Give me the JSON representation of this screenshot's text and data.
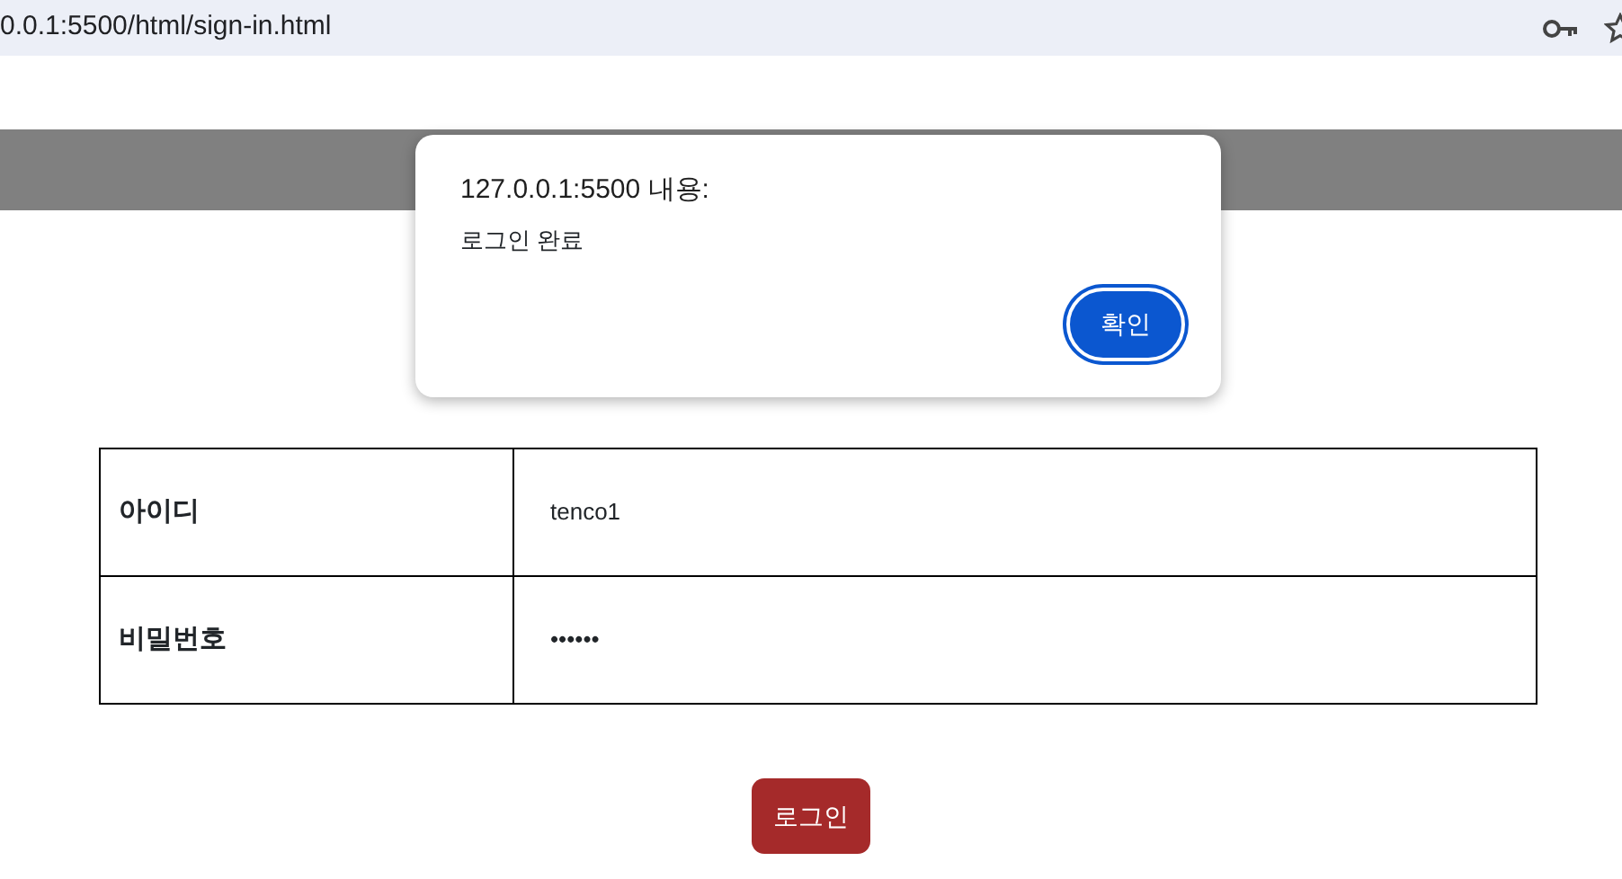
{
  "browser": {
    "address": "0.0.1:5500/html/sign-in.html"
  },
  "form": {
    "rows": [
      {
        "label": "아이디",
        "value": "tenco1"
      },
      {
        "label": "비밀번호",
        "value": "••••••"
      }
    ],
    "submit": "로그인"
  },
  "alert": {
    "title": "127.0.0.1:5500 내용:",
    "message": "로그인 완료",
    "ok": "확인"
  }
}
